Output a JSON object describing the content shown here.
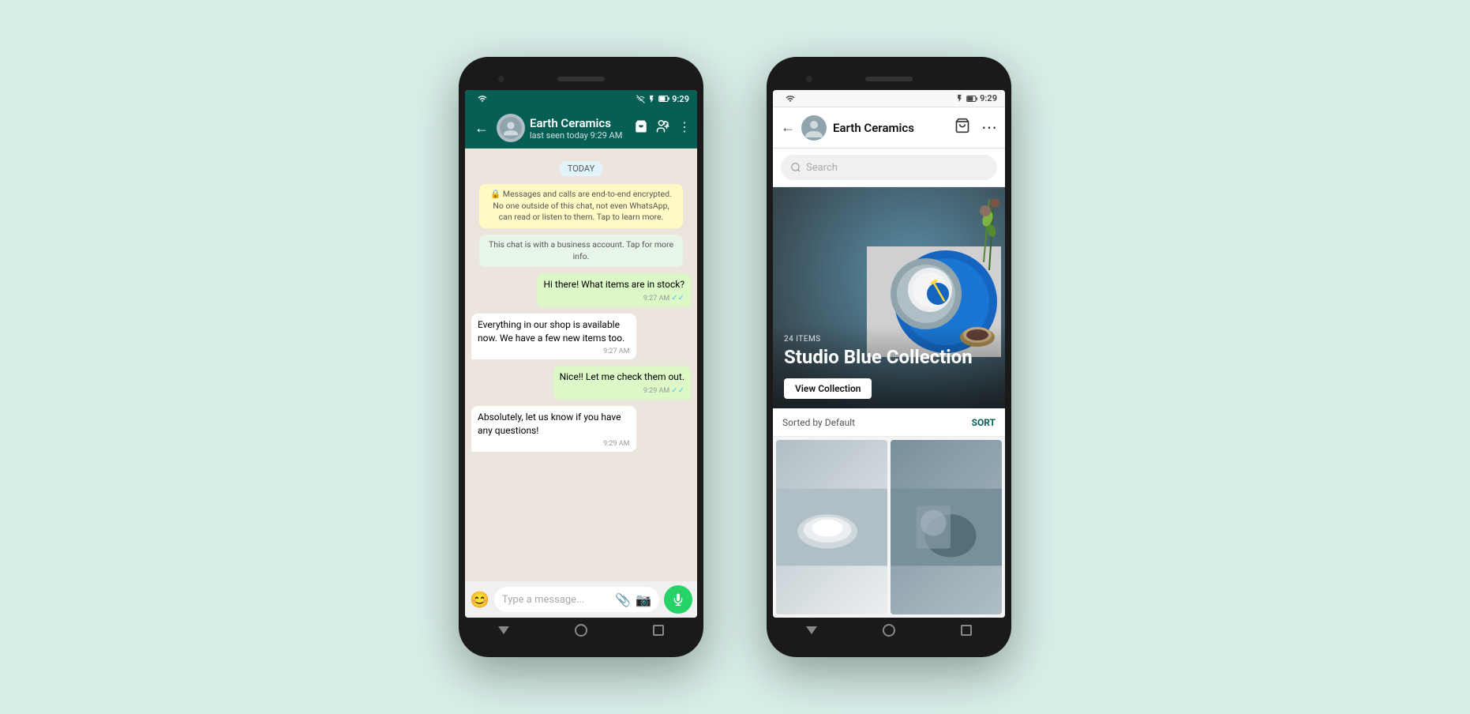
{
  "background_color": "#d8eee9",
  "phone1": {
    "title": "Earth Ceramics",
    "status_time": "9:29",
    "header": {
      "name": "Earth Ceramics",
      "status": "last seen today 9:29 AM",
      "back_label": "←"
    },
    "chat": {
      "date_label": "TODAY",
      "system_msg1": "🔒 Messages and calls are end-to-end encrypted. No one outside of this chat, not even WhatsApp, can read or listen to them. Tap to learn more.",
      "system_msg2": "This chat is with a business account. Tap for more info.",
      "messages": [
        {
          "type": "sent",
          "text": "Hi there! What items are in stock?",
          "time": "9:27 AM",
          "ticks": true
        },
        {
          "type": "received",
          "text": "Everything in our shop is available now. We have a few new items too.",
          "time": "9:27 AM",
          "ticks": false
        },
        {
          "type": "sent",
          "text": "Nice!! Let me check them out.",
          "time": "9:29 AM",
          "ticks": true
        },
        {
          "type": "received",
          "text": "Absolutely, let us know if you have any questions!",
          "time": "9:29 AM",
          "ticks": false
        }
      ]
    },
    "input": {
      "placeholder": "Type a message...",
      "emoji_label": "😊",
      "mic_label": "🎤"
    }
  },
  "phone2": {
    "title": "Earth Ceramics",
    "status_time": "9:29",
    "header": {
      "name": "Earth Ceramics",
      "back_label": "←"
    },
    "search": {
      "placeholder": "Search"
    },
    "banner": {
      "items_count": "24 ITEMS",
      "title": "Studio Blue Collection",
      "btn_label": "View Collection"
    },
    "sort": {
      "label": "Sorted by Default",
      "btn_label": "SORT"
    }
  }
}
